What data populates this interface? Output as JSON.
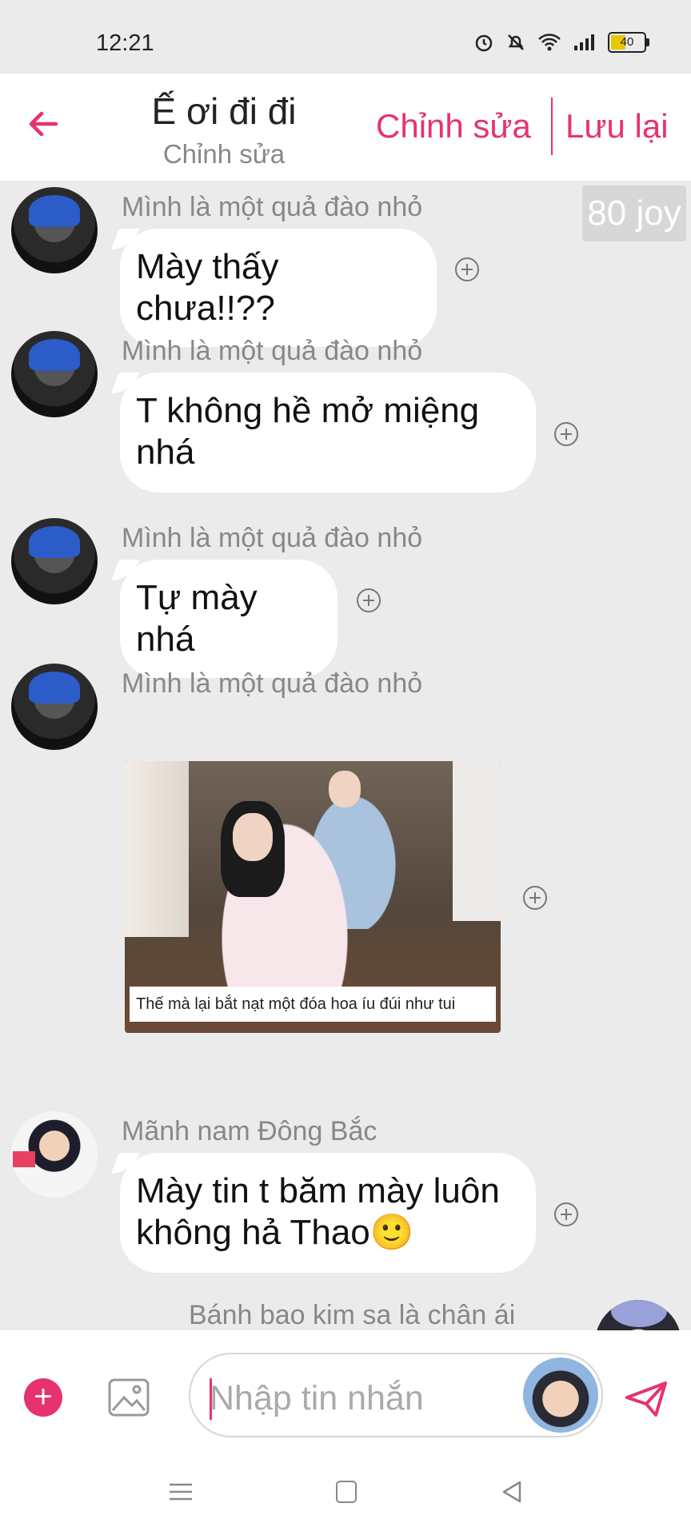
{
  "status_bar": {
    "time": "12:21",
    "battery": "40"
  },
  "header": {
    "title": "Ế ơi đi đi",
    "subtitle": "Chỉnh sửa",
    "edit_label": "Chỉnh sửa",
    "save_label": "Lưu lại"
  },
  "joy_badge": "80 joy",
  "messages": [
    {
      "sender": "Mình là một quả đào nhỏ",
      "text": "Mày thấy chưa!!??"
    },
    {
      "sender": "Mình là một quả đào nhỏ",
      "text": "T không hề mở miệng nhá"
    },
    {
      "sender": "Mình là một quả đào nhỏ",
      "text": "Tự mày nhá"
    },
    {
      "sender": "Mình là một quả đào nhỏ",
      "image_caption": "Thế mà lại bắt nạt một đóa hoa íu đúi như tui"
    },
    {
      "sender": "Mãnh nam Đông Bắc",
      "text": "Mày tin t băm mày luôn không hả Thao🙂"
    },
    {
      "sender": "Bánh bao kim sa là chân ái"
    }
  ],
  "composer": {
    "placeholder": "Nhập tin nhắn"
  },
  "theme": {
    "accent": "#e6336e",
    "background": "#ebebeb"
  },
  "icons": [
    "back-arrow-icon",
    "plus-icon",
    "image-icon",
    "send-icon",
    "menu-icon",
    "home-icon",
    "back-triangle-icon"
  ]
}
